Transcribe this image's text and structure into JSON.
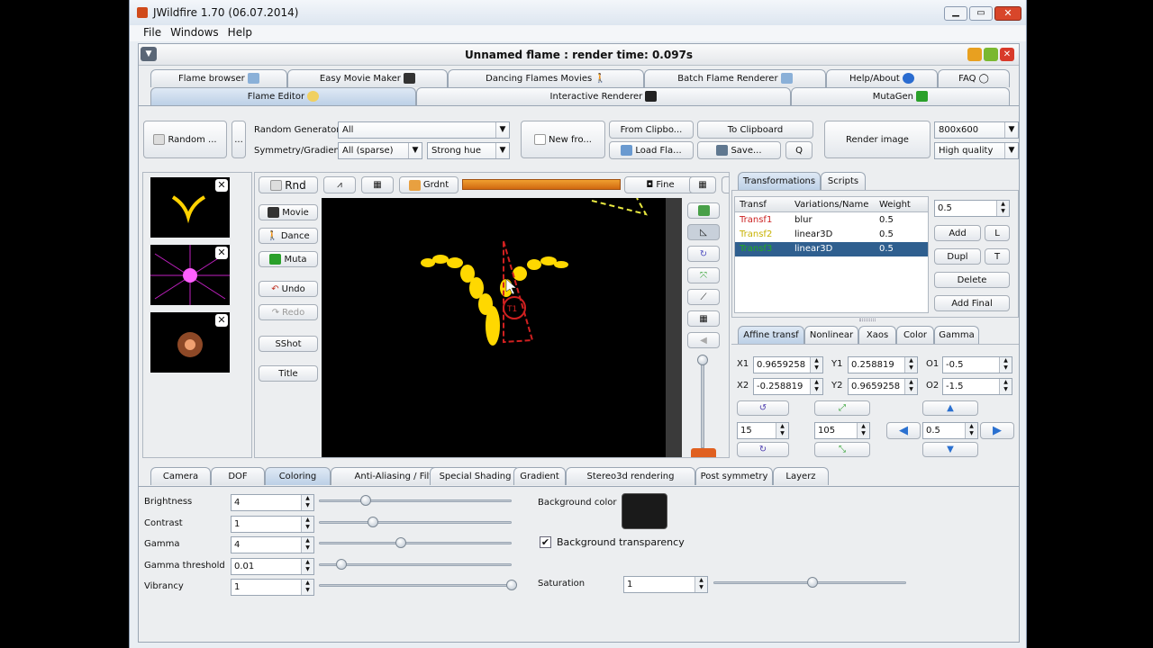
{
  "window": {
    "title": "JWildfire 1.70 (06.07.2014)",
    "menu": [
      "File",
      "Windows",
      "Help"
    ]
  },
  "frame": {
    "title": "Unnamed flame : render time: 0.097s"
  },
  "top_tabs_row1": [
    "Flame browser",
    "Easy Movie Maker",
    "Dancing Flames Movies",
    "Batch Flame Renderer",
    "Help/About",
    "FAQ"
  ],
  "top_tabs_row2": [
    "Flame Editor",
    "Interactive Renderer",
    "MutaGen"
  ],
  "toolbar": {
    "random_btn": "Random ...",
    "dots_btn": "...",
    "random_gen_label": "Random Generator",
    "random_gen_value": "All",
    "symmetry_label": "Symmetry/Gradient",
    "symmetry_value": "All (sparse)",
    "gradient_value": "Strong hue",
    "new_btn": "New fro...",
    "from_clip": "From Clipbo...",
    "load_flame": "Load Fla...",
    "to_clip": "To Clipboard",
    "save": "Save...",
    "q": "Q",
    "render_image": "Render image",
    "resolution": "800x600",
    "quality": "High quality"
  },
  "preview_toolbar": {
    "rnd": "Rnd",
    "grdnt": "Grdnt",
    "fine": "Fine"
  },
  "side_buttons": [
    "Movie",
    "Dance",
    "Muta",
    "Undo",
    "Redo",
    "SShot",
    "Title"
  ],
  "transform_tabs": [
    "Transformations",
    "Scripts"
  ],
  "transforms": {
    "columns": [
      "Transf",
      "Variations/Name",
      "Weight"
    ],
    "rows": [
      {
        "name": "Transf1",
        "variation": "blur",
        "weight": "0.5",
        "color": "#cc2222"
      },
      {
        "name": "Transf2",
        "variation": "linear3D",
        "weight": "0.5",
        "color": "#c8b200"
      },
      {
        "name": "Transf3",
        "variation": "linear3D",
        "weight": "0.5",
        "color": "#22aa22"
      }
    ],
    "weight_value": "0.5",
    "add": "Add",
    "l": "L",
    "dupl": "Dupl",
    "t": "T",
    "delete": "Delete",
    "add_final": "Add Final"
  },
  "affine_tabs": [
    "Affine transf",
    "Nonlinear",
    "Xaos",
    "Color",
    "Gamma"
  ],
  "affine": {
    "x1_label": "X1",
    "x1": "0.9659258",
    "y1_label": "Y1",
    "y1": "0.258819",
    "o1_label": "O1",
    "o1": "-0.5",
    "x2_label": "X2",
    "x2": "-0.258819",
    "y2_label": "Y2",
    "y2": "0.9659258",
    "o2_label": "O2",
    "o2": "-1.5",
    "rotate_amount": "15",
    "scale_amount": "105",
    "move_amount": "0.5"
  },
  "bottom_tabs": [
    "Camera",
    "DOF",
    "Coloring",
    "Anti-Aliasing / Filter",
    "Special Shading",
    "Gradient",
    "Stereo3d rendering",
    "Post symmetry",
    "Layerz"
  ],
  "coloring": {
    "brightness_label": "Brightness",
    "brightness": "4",
    "brightness_level": 0.22,
    "contrast_label": "Contrast",
    "contrast": "1",
    "contrast_level": 0.26,
    "gamma_label": "Gamma",
    "gamma": "4",
    "gamma_level": 0.41,
    "gamma_threshold_label": "Gamma threshold",
    "gamma_threshold": "0.01",
    "gamma_threshold_level": 0.09,
    "vibrancy_label": "Vibrancy",
    "vibrancy": "1",
    "vibrancy_level": 1.0,
    "bg_color_label": "Background color",
    "bg_transparency_label": "Background transparency",
    "saturation_label": "Saturation",
    "saturation": "1",
    "saturation_level": 0.5
  }
}
